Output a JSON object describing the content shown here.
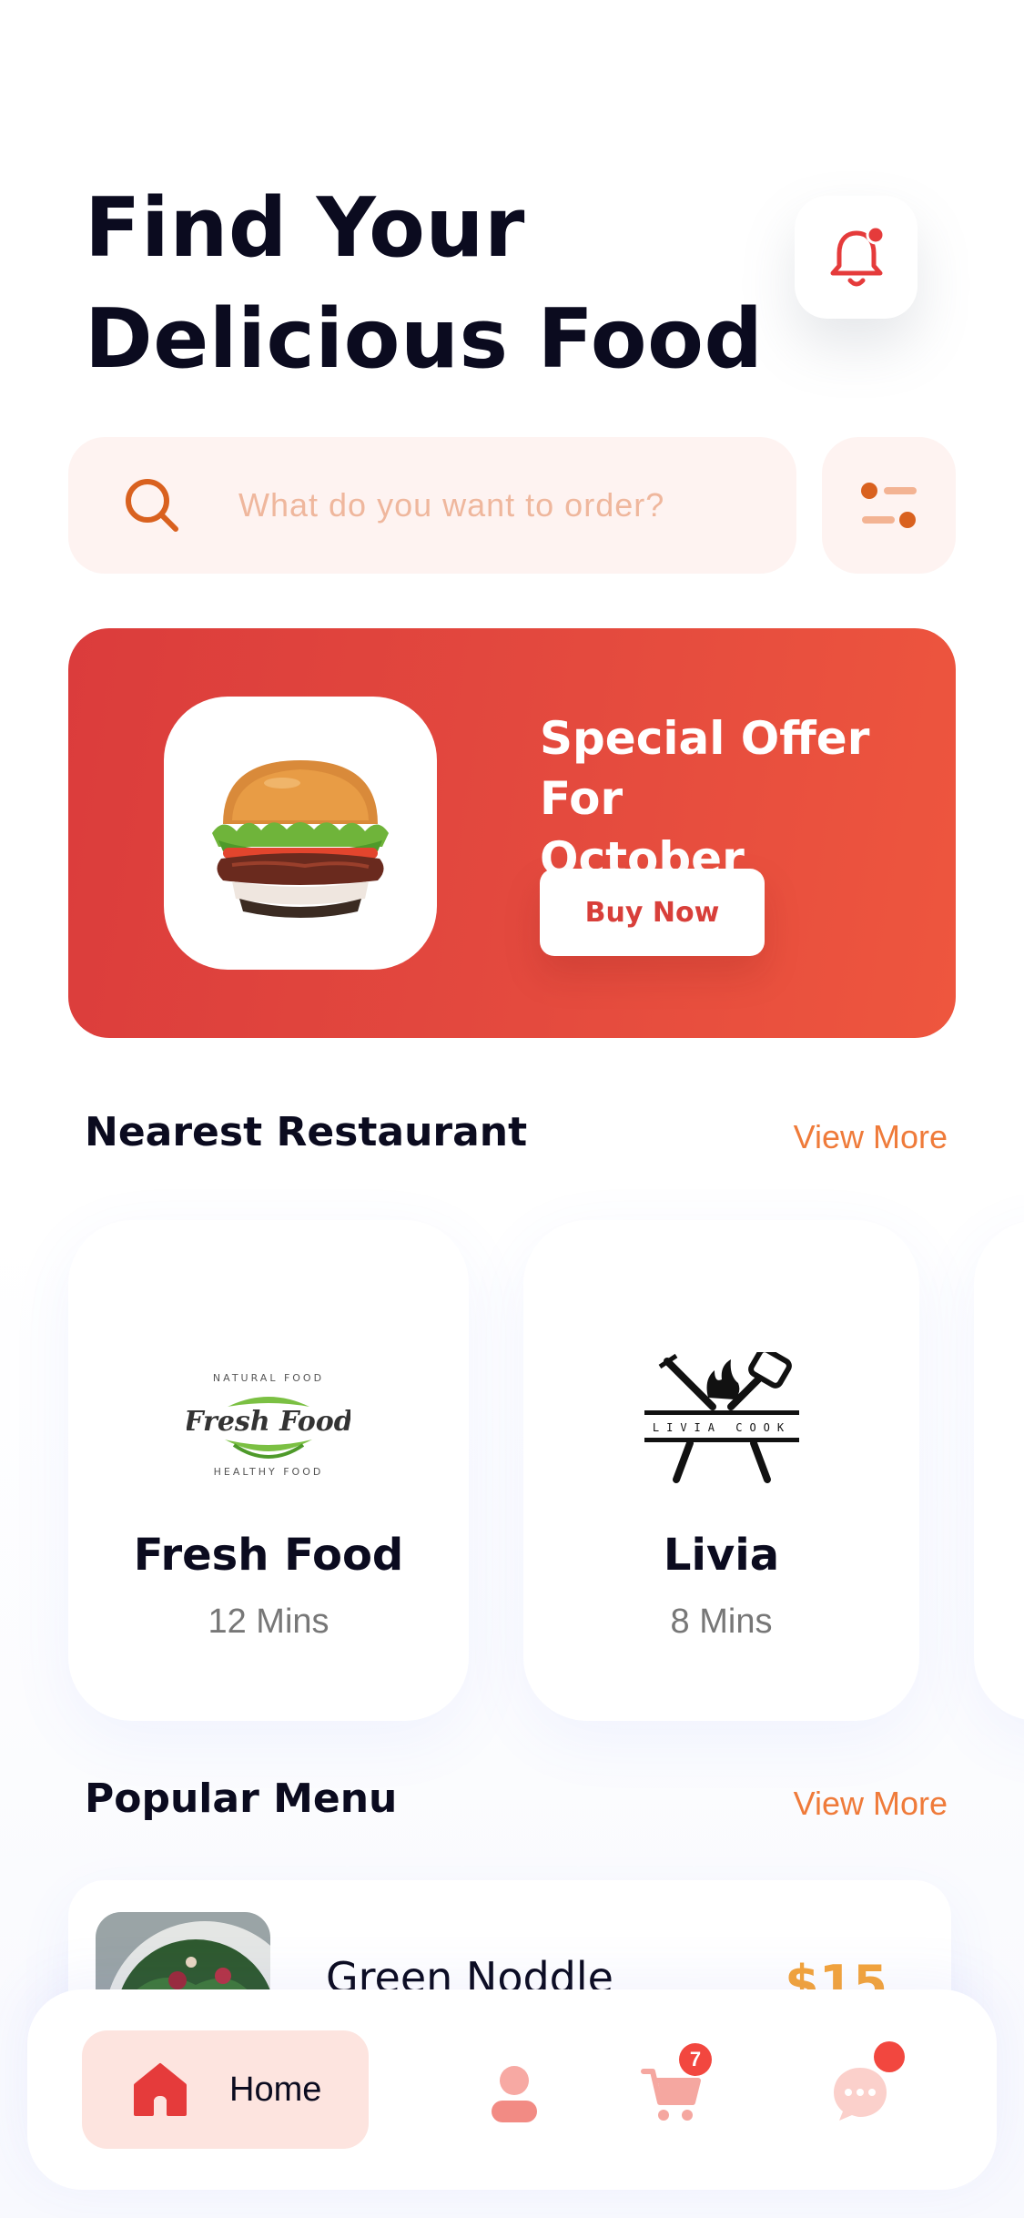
{
  "header": {
    "title_line1": "Find Your",
    "title_line2": "Delicious Food"
  },
  "search": {
    "placeholder": "What do you want to order?"
  },
  "promo": {
    "title_line1": "Special Offer For",
    "title_line2": "October",
    "button_label": "Buy Now"
  },
  "nearest": {
    "title": "Nearest Restaurant",
    "view_more": "View More",
    "restaurants": [
      {
        "name": "Fresh Food",
        "time": "12 Mins",
        "logo_text": "Fresh Food",
        "logo_top": "NATURAL FOOD",
        "logo_bottom": "HEALTHY FOOD"
      },
      {
        "name": "Livia",
        "time": "8 Mins",
        "logo_text": "LIVIA COOK"
      }
    ]
  },
  "popular": {
    "title": "Popular Menu",
    "view_more": "View More",
    "items": [
      {
        "name": "Green Noddle",
        "price": "$15"
      }
    ]
  },
  "bottom_nav": {
    "home_label": "Home",
    "cart_badge": "7"
  },
  "colors": {
    "accent": "#ef7b3a",
    "promo_start": "#db3c3c",
    "promo_end": "#ee563e",
    "badge": "#f2473f",
    "price": "#f4a43a"
  }
}
